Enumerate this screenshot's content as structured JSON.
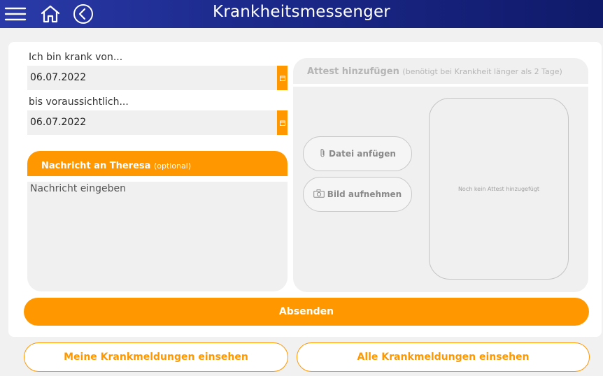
{
  "header": {
    "title": "Krankheitsmessenger",
    "icons": [
      "menu-icon",
      "home-icon",
      "back-icon"
    ]
  },
  "form": {
    "from_label": "Ich bin krank von...",
    "from_value": "06.07.2022",
    "until_label": "bis voraussichtlich...",
    "until_value": "06.07.2022",
    "calendar_icon": "calendar-icon"
  },
  "message": {
    "heading": "Nachricht an Theresa",
    "heading_note": "(optional)",
    "placeholder": "Nachricht eingeben"
  },
  "attest": {
    "heading": "Attest hinzufügen",
    "heading_note": "(benötigt bei Krankheit länger als 2 Tage)",
    "attach_label": "Datei anfügen",
    "photo_label": "Bild aufnehmen",
    "preview_empty": "Noch kein Attest hinzugefügt"
  },
  "actions": {
    "submit": "Absenden",
    "my_reports": "Meine Krankmeldungen einsehen",
    "all_reports": "Alle Krankmeldungen einsehen"
  },
  "colors": {
    "accent": "#ff9800",
    "header": "#1c2a8c",
    "panel": "#f0f0f0"
  }
}
